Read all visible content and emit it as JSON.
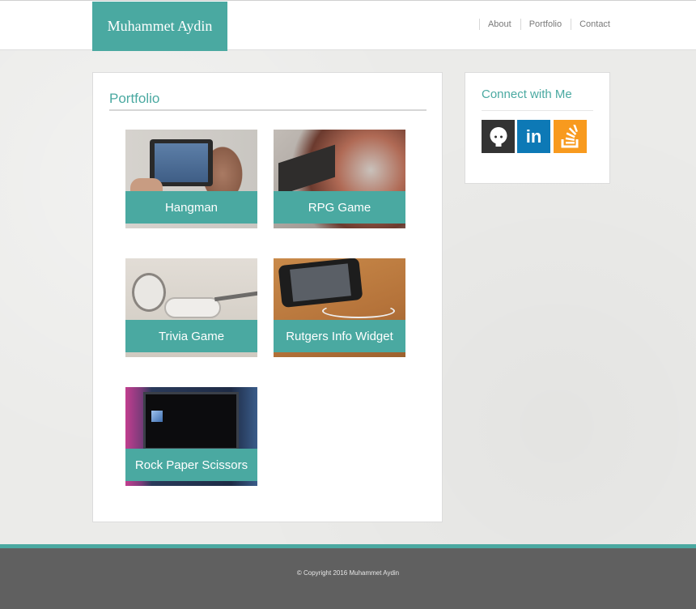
{
  "header": {
    "brand": "Muhammet Aydin",
    "nav": [
      "About",
      "Portfolio",
      "Contact"
    ]
  },
  "portfolio": {
    "title": "Portfolio",
    "items": [
      {
        "label": "Hangman",
        "image": "ipad-image"
      },
      {
        "label": "RPG Game",
        "image": "dj-turntable-image"
      },
      {
        "label": "Trivia Game",
        "image": "earbuds-image"
      },
      {
        "label": "Rutgers Info Widget",
        "image": "smartphone-image"
      },
      {
        "label": "Rock Paper Scissors",
        "image": "led-tv-image"
      }
    ]
  },
  "sidebar": {
    "title": "Connect with Me",
    "links": [
      {
        "name": "github",
        "icon": "github-icon"
      },
      {
        "name": "linkedin",
        "icon": "linkedin-icon",
        "glyph": "in"
      },
      {
        "name": "stackoverflow",
        "icon": "stackoverflow-icon"
      }
    ]
  },
  "footer": {
    "copyright": "© Copyright 2016 Muhammet Aydin"
  },
  "colors": {
    "accent": "#4aa9a1",
    "footer": "#606060",
    "github": "#333333",
    "linkedin": "#0d79b6",
    "stackoverflow": "#f89a1e"
  }
}
